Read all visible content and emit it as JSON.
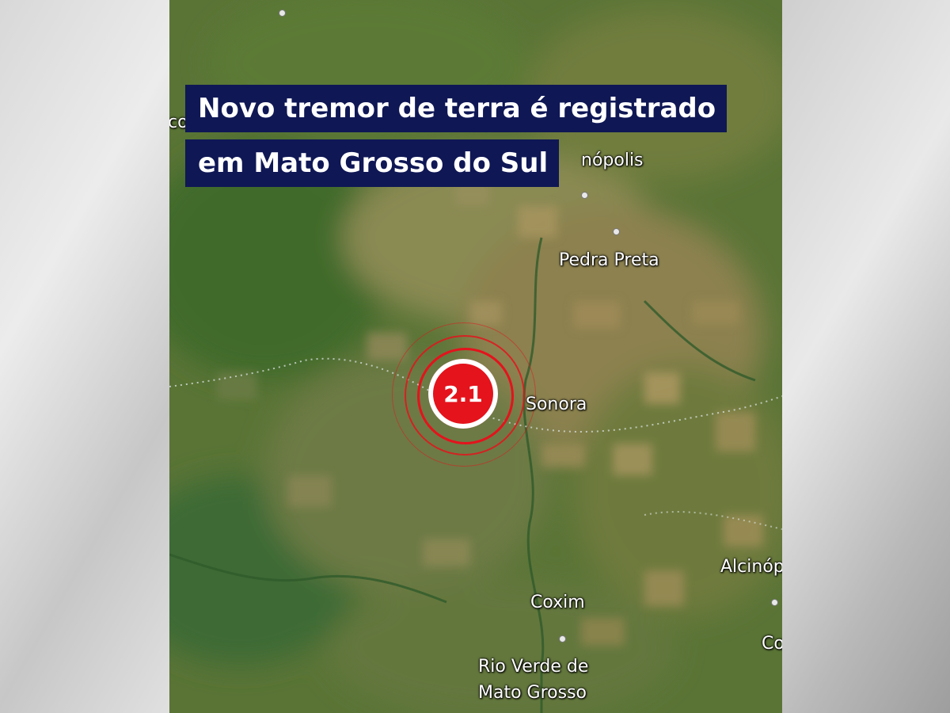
{
  "headline": {
    "line1": "Novo tremor de terra é registrado",
    "line2": "em Mato Grosso do Sul"
  },
  "earthquake": {
    "magnitude": "2.1",
    "marker_color": "#e4131c"
  },
  "places": {
    "rondonopolis_partial": "nópolis",
    "pedra_preta": "Pedra Preta",
    "sonora": "Sonora",
    "alcinopolis_partial": "Alcinóp",
    "coxim": "Coxim",
    "rio_verde_line1": "Rio Verde de",
    "rio_verde_line2": "Mato Grosso",
    "left_edge_partial": "co",
    "right_edge_partial": "Co"
  },
  "colors": {
    "headline_background": "#0f1755",
    "headline_text": "#ffffff"
  }
}
